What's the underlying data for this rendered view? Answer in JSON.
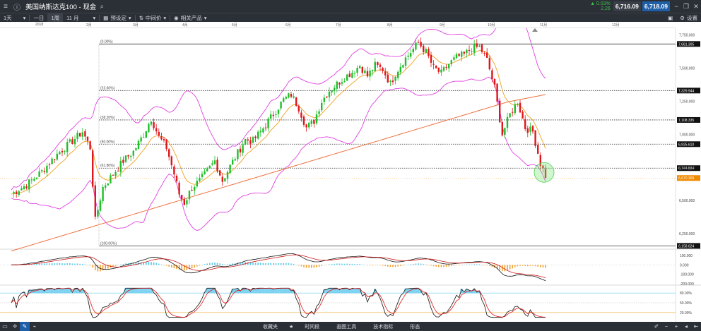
{
  "header": {
    "title": "美国纳斯达克100 - 现金",
    "change_pct": "▲ 0.03%",
    "change_val": "2.26",
    "sell": "6,716.09",
    "buy": "6,718.09"
  },
  "toolbar": {
    "interval": "1天",
    "range_1d": "一日",
    "range_1w": "1周",
    "range_month": "11 月",
    "preset": "预设定",
    "midprice": "中间价",
    "related": "相关产品",
    "settings": "设置"
  },
  "time_axis": {
    "labels": [
      "2018",
      "2月",
      "3月",
      "4月",
      "5月",
      "6月",
      "7月",
      "8月",
      "9月",
      "10月",
      "11月",
      "12月"
    ]
  },
  "price_axis": {
    "labels": [
      "7,750.000",
      "7,500.000",
      "7,250.000",
      "7,000.000",
      "6,750.000",
      "6,500.000",
      "6,250.000"
    ],
    "fib_labels": [
      "7,681.305",
      "7,329.944",
      "7,108.335",
      "6,925.610",
      "6,744.884",
      "6,158.624"
    ],
    "current": "6,670.309"
  },
  "fib_levels": [
    "(0.00%)",
    "(23.60%)",
    "(38.20%)",
    "(50.00%)",
    "(61.80%)",
    "(100.00%)"
  ],
  "macd_axis": [
    "100.000",
    "0.000",
    "-100.000",
    "-200.000"
  ],
  "stoch_axis": [
    "80.00%",
    "50.00%",
    "20.00%"
  ],
  "colors": {
    "up": "#1fbf2a",
    "down": "#e0161c",
    "bollinger": "#e040e0",
    "ma_orange": "#f0a020",
    "ma_long": "#f07040",
    "macd_hist_pos": "#4fc8e8",
    "macd_hist_neg": "#f0a030",
    "stoch_k": "#111111",
    "stoch_d": "#e01818",
    "stoch_fill": "#5cc8ee"
  },
  "statusbar": {
    "favorites": "收藏夹",
    "timeline": "时间段",
    "drawing": "画图工具",
    "indicators": "技术指标",
    "patterns": "形态"
  },
  "chart_data": {
    "type": "candlestick",
    "instrument": "美国纳斯达克100 - 现金",
    "interval": "1天",
    "x_labels": [
      "2018",
      "2月",
      "3月",
      "4月",
      "5月",
      "6月",
      "7月",
      "8月",
      "9月",
      "10月",
      "11月",
      "12月"
    ],
    "ylim": [
      6150,
      7800
    ],
    "y_ticks": [
      6250,
      6500,
      6750,
      7000,
      7250,
      7500,
      7750
    ],
    "fibonacci": [
      {
        "level": "(0.00%)",
        "price": 7681.305
      },
      {
        "level": "(23.60%)",
        "price": 7329.944
      },
      {
        "level": "(38.20%)",
        "price": 7108.335
      },
      {
        "level": "(50.00%)",
        "price": 6925.61
      },
      {
        "level": "(61.80%)",
        "price": 6744.884
      },
      {
        "level": "(100.00%)",
        "price": 6158.624
      }
    ],
    "last_price": 6670.309,
    "close_path": [
      [
        0,
        6550
      ],
      [
        6,
        6620
      ],
      [
        12,
        6720
      ],
      [
        18,
        6850
      ],
      [
        24,
        6950
      ],
      [
        28,
        7020
      ],
      [
        31,
        6900
      ],
      [
        33,
        6350
      ],
      [
        36,
        6600
      ],
      [
        40,
        6700
      ],
      [
        44,
        6800
      ],
      [
        48,
        6870
      ],
      [
        52,
        7000
      ],
      [
        55,
        7120
      ],
      [
        58,
        6980
      ],
      [
        61,
        6900
      ],
      [
        64,
        6700
      ],
      [
        66,
        6550
      ],
      [
        68,
        6480
      ],
      [
        71,
        6600
      ],
      [
        74,
        6650
      ],
      [
        77,
        6720
      ],
      [
        80,
        6800
      ],
      [
        83,
        6650
      ],
      [
        86,
        6760
      ],
      [
        89,
        6860
      ],
      [
        92,
        6960
      ],
      [
        95,
        6950
      ],
      [
        98,
        7020
      ],
      [
        101,
        7100
      ],
      [
        104,
        7180
      ],
      [
        107,
        7260
      ],
      [
        110,
        7300
      ],
      [
        113,
        7200
      ],
      [
        116,
        7050
      ],
      [
        119,
        7100
      ],
      [
        122,
        7250
      ],
      [
        125,
        7330
      ],
      [
        128,
        7380
      ],
      [
        131,
        7430
      ],
      [
        134,
        7470
      ],
      [
        137,
        7520
      ],
      [
        140,
        7440
      ],
      [
        143,
        7520
      ],
      [
        146,
        7490
      ],
      [
        149,
        7380
      ],
      [
        151,
        7460
      ],
      [
        154,
        7550
      ],
      [
        157,
        7620
      ],
      [
        160,
        7690
      ],
      [
        163,
        7620
      ],
      [
        166,
        7500
      ],
      [
        169,
        7460
      ],
      [
        172,
        7530
      ],
      [
        175,
        7580
      ],
      [
        178,
        7600
      ],
      [
        181,
        7650
      ],
      [
        184,
        7660
      ],
      [
        187,
        7560
      ],
      [
        190,
        7350
      ],
      [
        193,
        7000
      ],
      [
        196,
        7150
      ],
      [
        199,
        7250
      ],
      [
        202,
        7050
      ],
      [
        205,
        7020
      ],
      [
        208,
        6780
      ],
      [
        210,
        6690
      ]
    ],
    "macd_range": [
      -200,
      130
    ],
    "stochastic_levels": [
      80,
      50,
      20
    ]
  }
}
